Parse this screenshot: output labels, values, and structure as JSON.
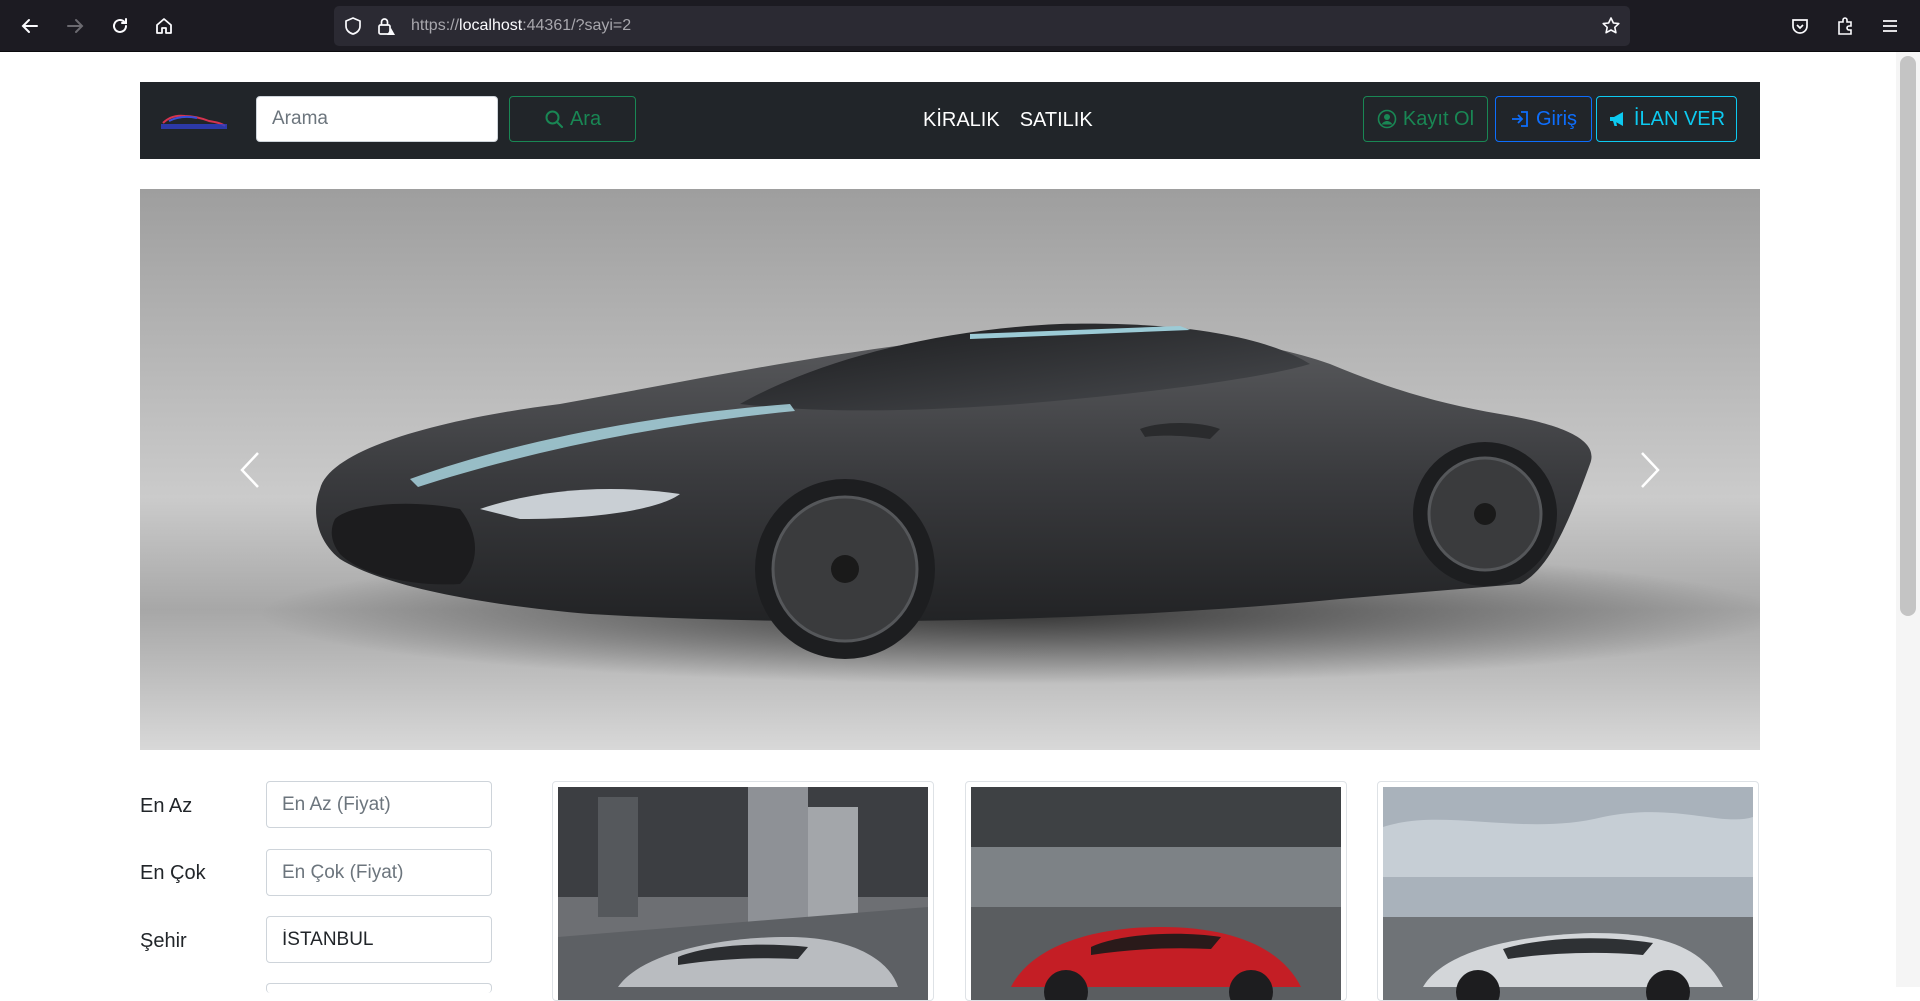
{
  "browser": {
    "url_scheme": "https://",
    "url_host": "localhost",
    "url_rest": ":44361/?sayi=2"
  },
  "navbar": {
    "search_placeholder": "Arama",
    "search_button": "Ara",
    "links": [
      "KİRALIK",
      "SATILIK"
    ],
    "register_button": "Kayıt Ol",
    "login_button": "Giriş",
    "post_ad_button": "İLAN VER"
  },
  "colors": {
    "navbar_bg": "#212529",
    "success": "#198754",
    "primary": "#0d6efd",
    "info": "#0dcaf0"
  },
  "filters": {
    "min_label": "En Az",
    "min_placeholder": "En Az (Fiyat)",
    "max_label": "En Çok",
    "max_placeholder": "En Çok (Fiyat)",
    "city_label": "Şehir",
    "city_value": "İSTANBUL"
  },
  "icons": {
    "search": "search-icon",
    "user": "user-circle-icon",
    "login": "login-icon",
    "megaphone": "megaphone-icon",
    "prev": "chevron-left-icon",
    "next": "chevron-right-icon"
  }
}
